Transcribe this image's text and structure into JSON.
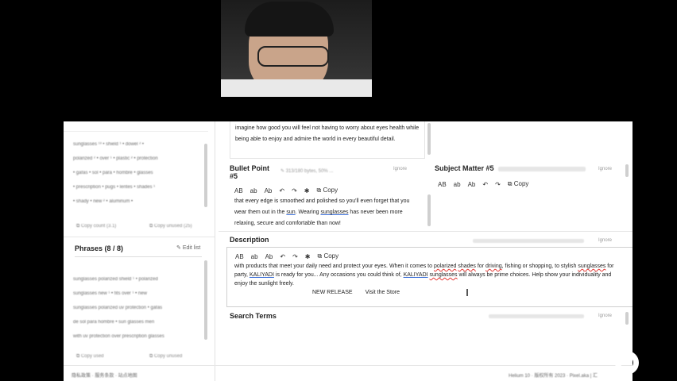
{
  "left_sidebar": {
    "keywords_rows": [
      "sunglasses ¹³ • shield ¹ • dowel ² •",
      "polarized ² • over ¹ • plastic ² • protection",
      "• gafas • sol • para • hombre • glasses",
      "• prescription • pugs • lentes • shades ¹",
      "• shady • new ² • aluminum •"
    ],
    "copy_count": "Copy count (3.1)",
    "copy_unused_1": "Copy unused (25)",
    "phrases_title": "Phrases (8 / 8)",
    "edit_list": "Edit list",
    "phrase_rows": [
      "sunglasses polarized shield ¹ • polarized",
      "sunglasses new ¹ • fits over ¹ • new",
      "sunglasses polarized uv protection • gafas",
      "de sol para hombre • sun glasses men",
      "with uv protection over prescription glasses"
    ],
    "copy_used": "Copy used",
    "copy_unused_2": "Copy unused"
  },
  "top_panel": {
    "text": "imagine how good you will feel not having to worry about eyes health while being able to enjoy and admire the world in every beautiful detail."
  },
  "bullet5": {
    "label": "Bullet Point #5",
    "counter": "313/180 bytes, 50% ...",
    "ignore": "Ignore",
    "text_a": "that every edge is smoothed and polished so you'll even forget that you wear them out in the ",
    "word_sun": "sun",
    "text_b": ". Wearing ",
    "word_sunglasses": "sunglasses",
    "text_c": " has never been more relaxing, secure and comfortable than now!"
  },
  "subject_matter": {
    "label": "Subject Matter #5",
    "ignore": "Ignore"
  },
  "toolbar": {
    "ab_upper": "AB",
    "ab_lower": "ab",
    "ab_title": "Ab",
    "undo": "↶",
    "redo": "↷",
    "wand": "✱",
    "copy": "Copy"
  },
  "description": {
    "label": "Description",
    "ignore": "Ignore",
    "t1": "with products that meet your daily need and protect your eyes.      When it comes to ",
    "w_polarized": "polarized",
    "t2": " ",
    "w_shades": "shades",
    "t3": " for ",
    "w_driving": "driving",
    "t4": ", fishing or shopping, to stylish ",
    "w_sunglasses1": "sunglasses",
    "t5": " for party, ",
    "w_kaliyadi1": "KALIYADI",
    "t6": " is ready for you...      Any occasions you could think of, ",
    "w_kaliyadi2": "KALIYADI",
    "t7": " ",
    "w_sunglasses2": "sunglasses",
    "t8": " will always be prime choices. Help show your individuality and enjoy the sunlight freely.",
    "new_release": "NEW RELEASE",
    "visit_store": "Visit the Store"
  },
  "search_terms": {
    "label": "Search Terms",
    "ignore": "Ignore"
  },
  "footer": {
    "left": "隐私政策 · 服务条款 · 站点地图",
    "right": "Helium 10 · 版权所有 2023 · Pixel.aka | 汇"
  }
}
